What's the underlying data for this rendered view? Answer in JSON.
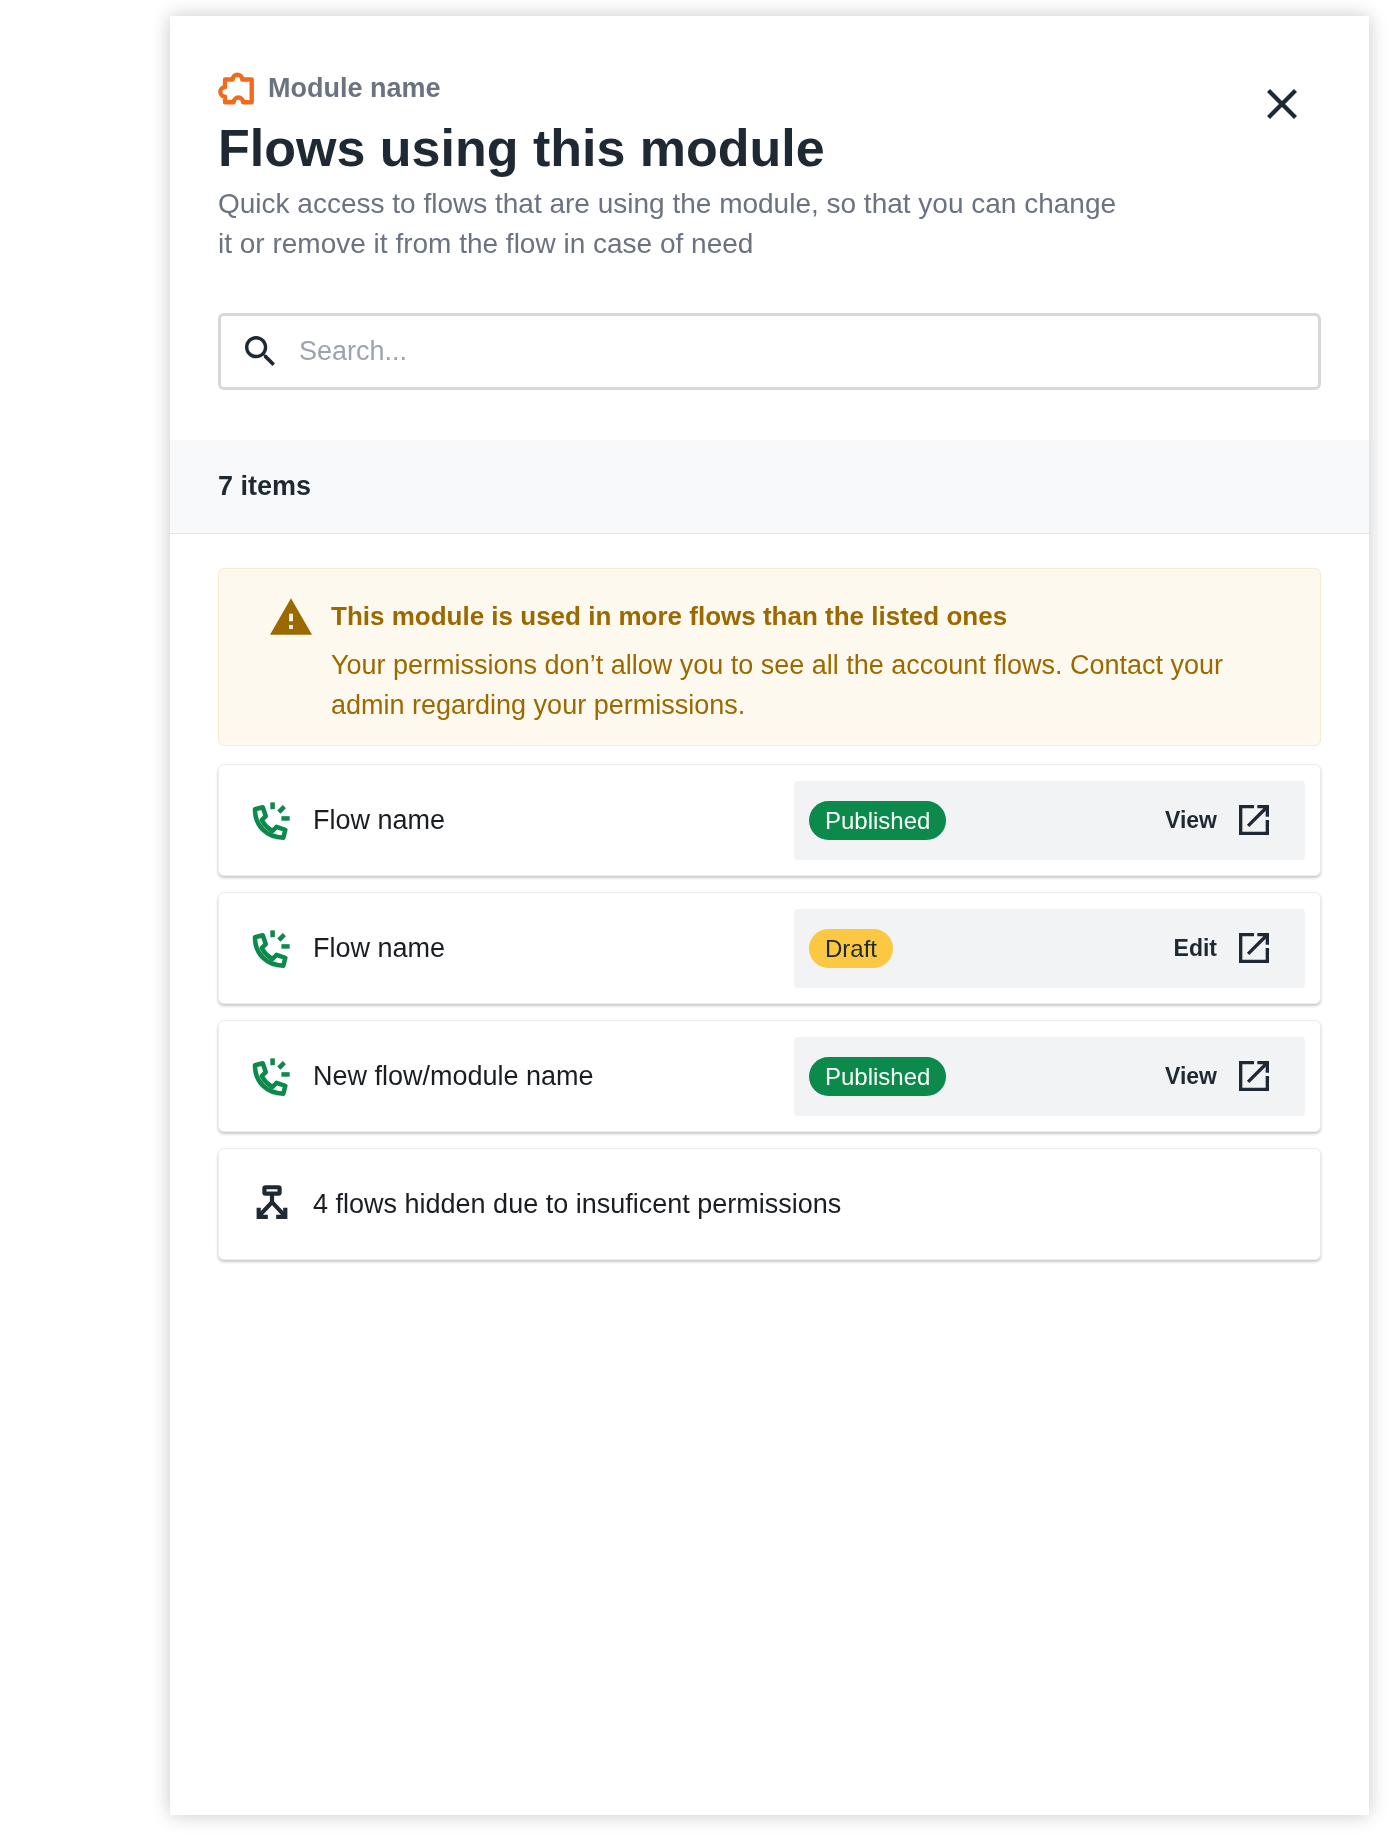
{
  "panel": {
    "module_label": "Module name",
    "title": "Flows using this module",
    "description": "Quick access to flows that are using the module, so that you can change it or remove it from the flow in case of need"
  },
  "search": {
    "placeholder": "Search..."
  },
  "list": {
    "count": "7 items",
    "alert": {
      "title": "This module is used in more flows than the listed ones",
      "message": "Your permissions don’t allow you to see all the account flows. Contact your admin regarding your permissions."
    },
    "rows": [
      {
        "kind": "flow",
        "name": "Flow name",
        "status": {
          "label": "Published",
          "color": "#0b8a4b"
        },
        "action": "View"
      },
      {
        "kind": "flow",
        "name": "Flow name",
        "status": {
          "label": "Draft",
          "color": "#fcc843"
        },
        "action": "Edit"
      },
      {
        "kind": "flow",
        "name": "New flow/module name",
        "status": {
          "label": "Published",
          "color": "#0b8a4b"
        },
        "action": "View"
      },
      {
        "kind": "hidden",
        "name": "4 flows hidden due to insuficent permissions"
      }
    ]
  }
}
